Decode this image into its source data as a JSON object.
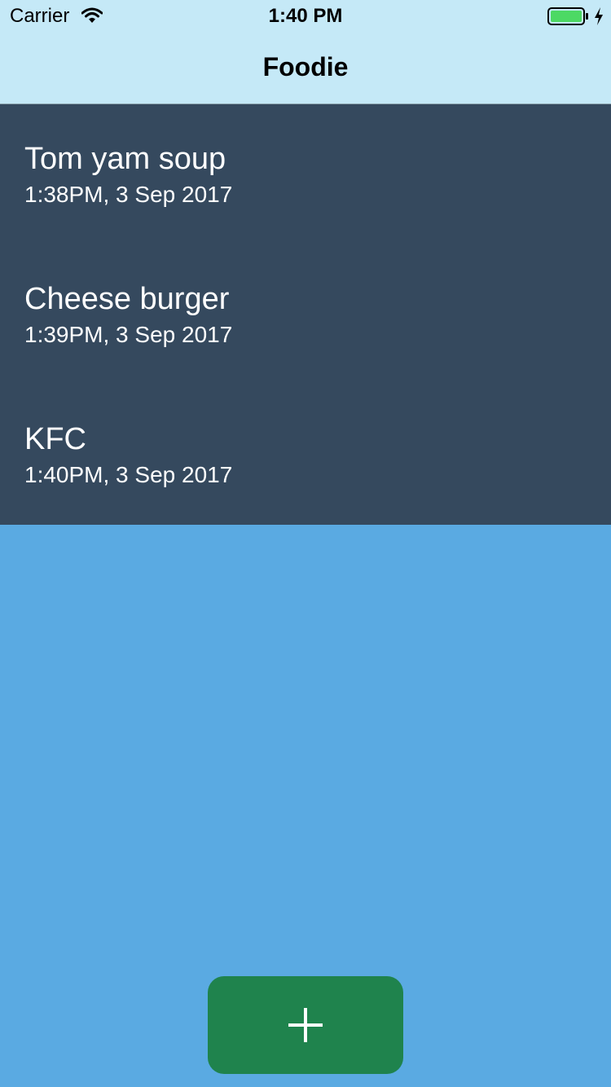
{
  "status_bar": {
    "carrier": "Carrier",
    "time": "1:40 PM",
    "icons": [
      "wifi-icon",
      "battery-icon",
      "charging-bolt-icon"
    ]
  },
  "nav": {
    "title": "Foodie"
  },
  "food_list": [
    {
      "name": "Tom yam soup",
      "time": "1:38PM, 3 Sep 2017"
    },
    {
      "name": "Cheese burger",
      "time": "1:39PM, 3 Sep 2017"
    },
    {
      "name": "KFC",
      "time": "1:40PM, 3 Sep 2017"
    }
  ],
  "add_button": {
    "icon": "plus-icon"
  },
  "colors": {
    "header_bg": "#c5e9f7",
    "list_bg": "#35495e",
    "page_bg": "#5aaae2",
    "button_bg": "#1f834d",
    "battery_fill": "#4cd964"
  }
}
